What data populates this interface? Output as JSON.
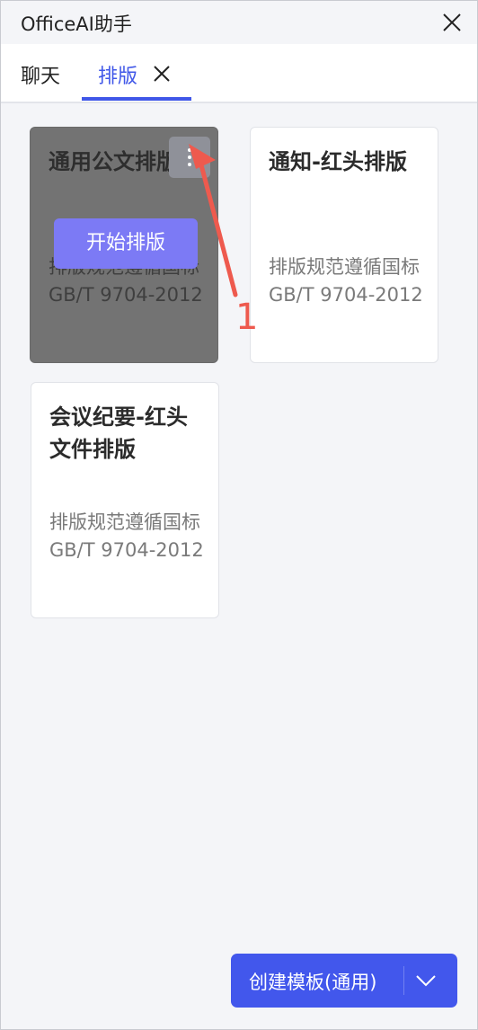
{
  "window": {
    "title": "OfficeAI助手"
  },
  "tabs": [
    {
      "label": "聊天",
      "active": false
    },
    {
      "label": "排版",
      "active": true
    }
  ],
  "templates": [
    {
      "title": "通用公文排版",
      "description": "排版规范遵循国标GB/T 9704-2012",
      "action_label": "开始排版",
      "hovered": true
    },
    {
      "title": "通知-红头排版",
      "description": "排版规范遵循国标GB/T 9704-2012"
    },
    {
      "title": "会议纪要-红头文件排版",
      "description": "排版规范遵循国标GB/T 9704-2012"
    }
  ],
  "annotation": {
    "label": "1",
    "color": "#ee5a4e"
  },
  "create_button": {
    "label": "创建模板(通用)"
  },
  "colors": {
    "accent": "#4057e8",
    "start_button": "#7c7af5",
    "annotation": "#ee5a4e"
  },
  "icons": [
    "close-icon",
    "tab-close-icon",
    "more-vertical-icon",
    "chevron-down-icon"
  ]
}
